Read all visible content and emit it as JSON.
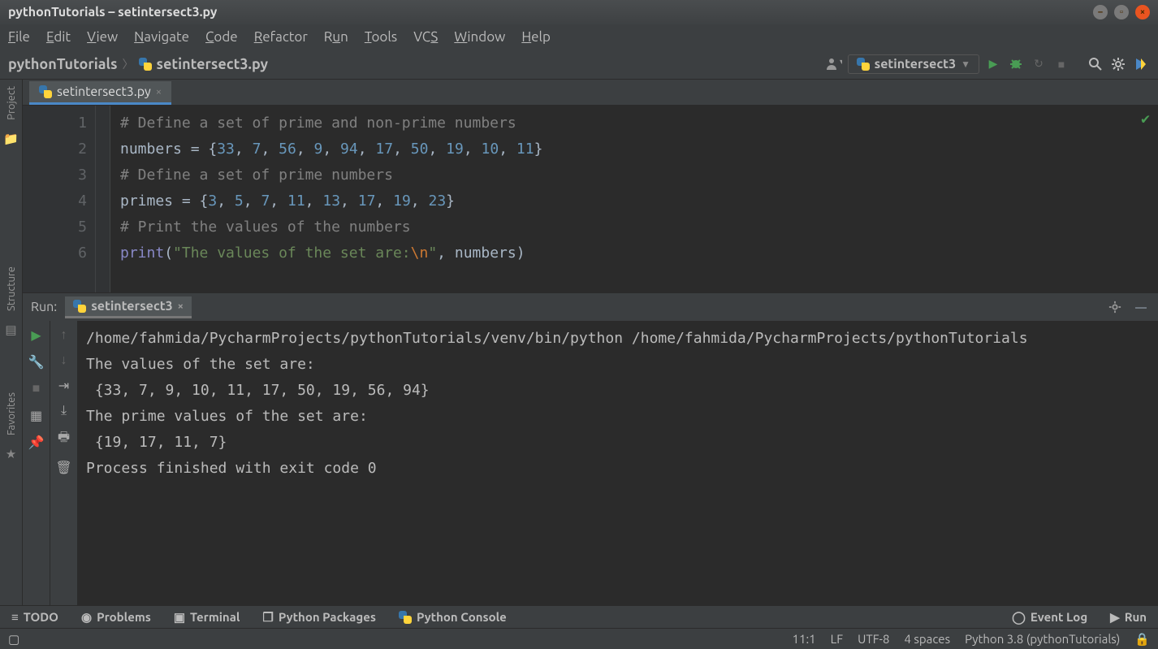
{
  "window": {
    "title": "pythonTutorials – setintersect3.py"
  },
  "menu": {
    "file": "File",
    "edit": "Edit",
    "view": "View",
    "navigate": "Navigate",
    "code": "Code",
    "refactor": "Refactor",
    "run": "Run",
    "tools": "Tools",
    "vcs": "VCS",
    "window": "Window",
    "help": "Help"
  },
  "breadcrumb": {
    "project": "pythonTutorials",
    "file": "setintersect3.py"
  },
  "run_config": {
    "name": "setintersect3"
  },
  "sidebar": {
    "project": "Project",
    "structure": "Structure",
    "favorites": "Favorites"
  },
  "editor_tab": {
    "name": "setintersect3.py"
  },
  "code": {
    "lines": [
      "1",
      "2",
      "3",
      "4",
      "5",
      "6"
    ],
    "l1_comment": "# Define a set of prime and non-prime numbers",
    "l2_var": "numbers",
    "l2_eq": " = {",
    "l2_nums": [
      "33",
      "7",
      "56",
      "9",
      "94",
      "17",
      "50",
      "19",
      "10",
      "11"
    ],
    "l2_close": "}",
    "l3_comment": "# Define a set of prime numbers",
    "l4_var": "primes",
    "l4_eq": " = {",
    "l4_nums": [
      "3",
      "5",
      "7",
      "11",
      "13",
      "17",
      "19",
      "23"
    ],
    "l4_close": "}",
    "l5_comment": "# Print the values of the numbers",
    "l6_fn": "print",
    "l6_open": "(",
    "l6_str_a": "\"The values of the set are:",
    "l6_esc": "\\n",
    "l6_str_b": "\"",
    "l6_comma": ", ",
    "l6_arg": "numbers",
    "l6_close": ")"
  },
  "run_panel": {
    "label": "Run:",
    "tab": "setintersect3",
    "output": [
      "/home/fahmida/PycharmProjects/pythonTutorials/venv/bin/python /home/fahmida/PycharmProjects/pythonTutorials",
      "The values of the set are:",
      " {33, 7, 9, 10, 11, 17, 50, 19, 56, 94}",
      "The prime values of the set are:",
      " {19, 17, 11, 7}",
      "",
      "Process finished with exit code 0"
    ]
  },
  "bottom": {
    "todo": "TODO",
    "problems": "Problems",
    "terminal": "Terminal",
    "packages": "Python Packages",
    "console": "Python Console",
    "event_log": "Event Log",
    "run": "Run"
  },
  "status": {
    "pos": "11:1",
    "le": "LF",
    "enc": "UTF-8",
    "indent": "4 spaces",
    "interp": "Python 3.8 (pythonTutorials)"
  }
}
